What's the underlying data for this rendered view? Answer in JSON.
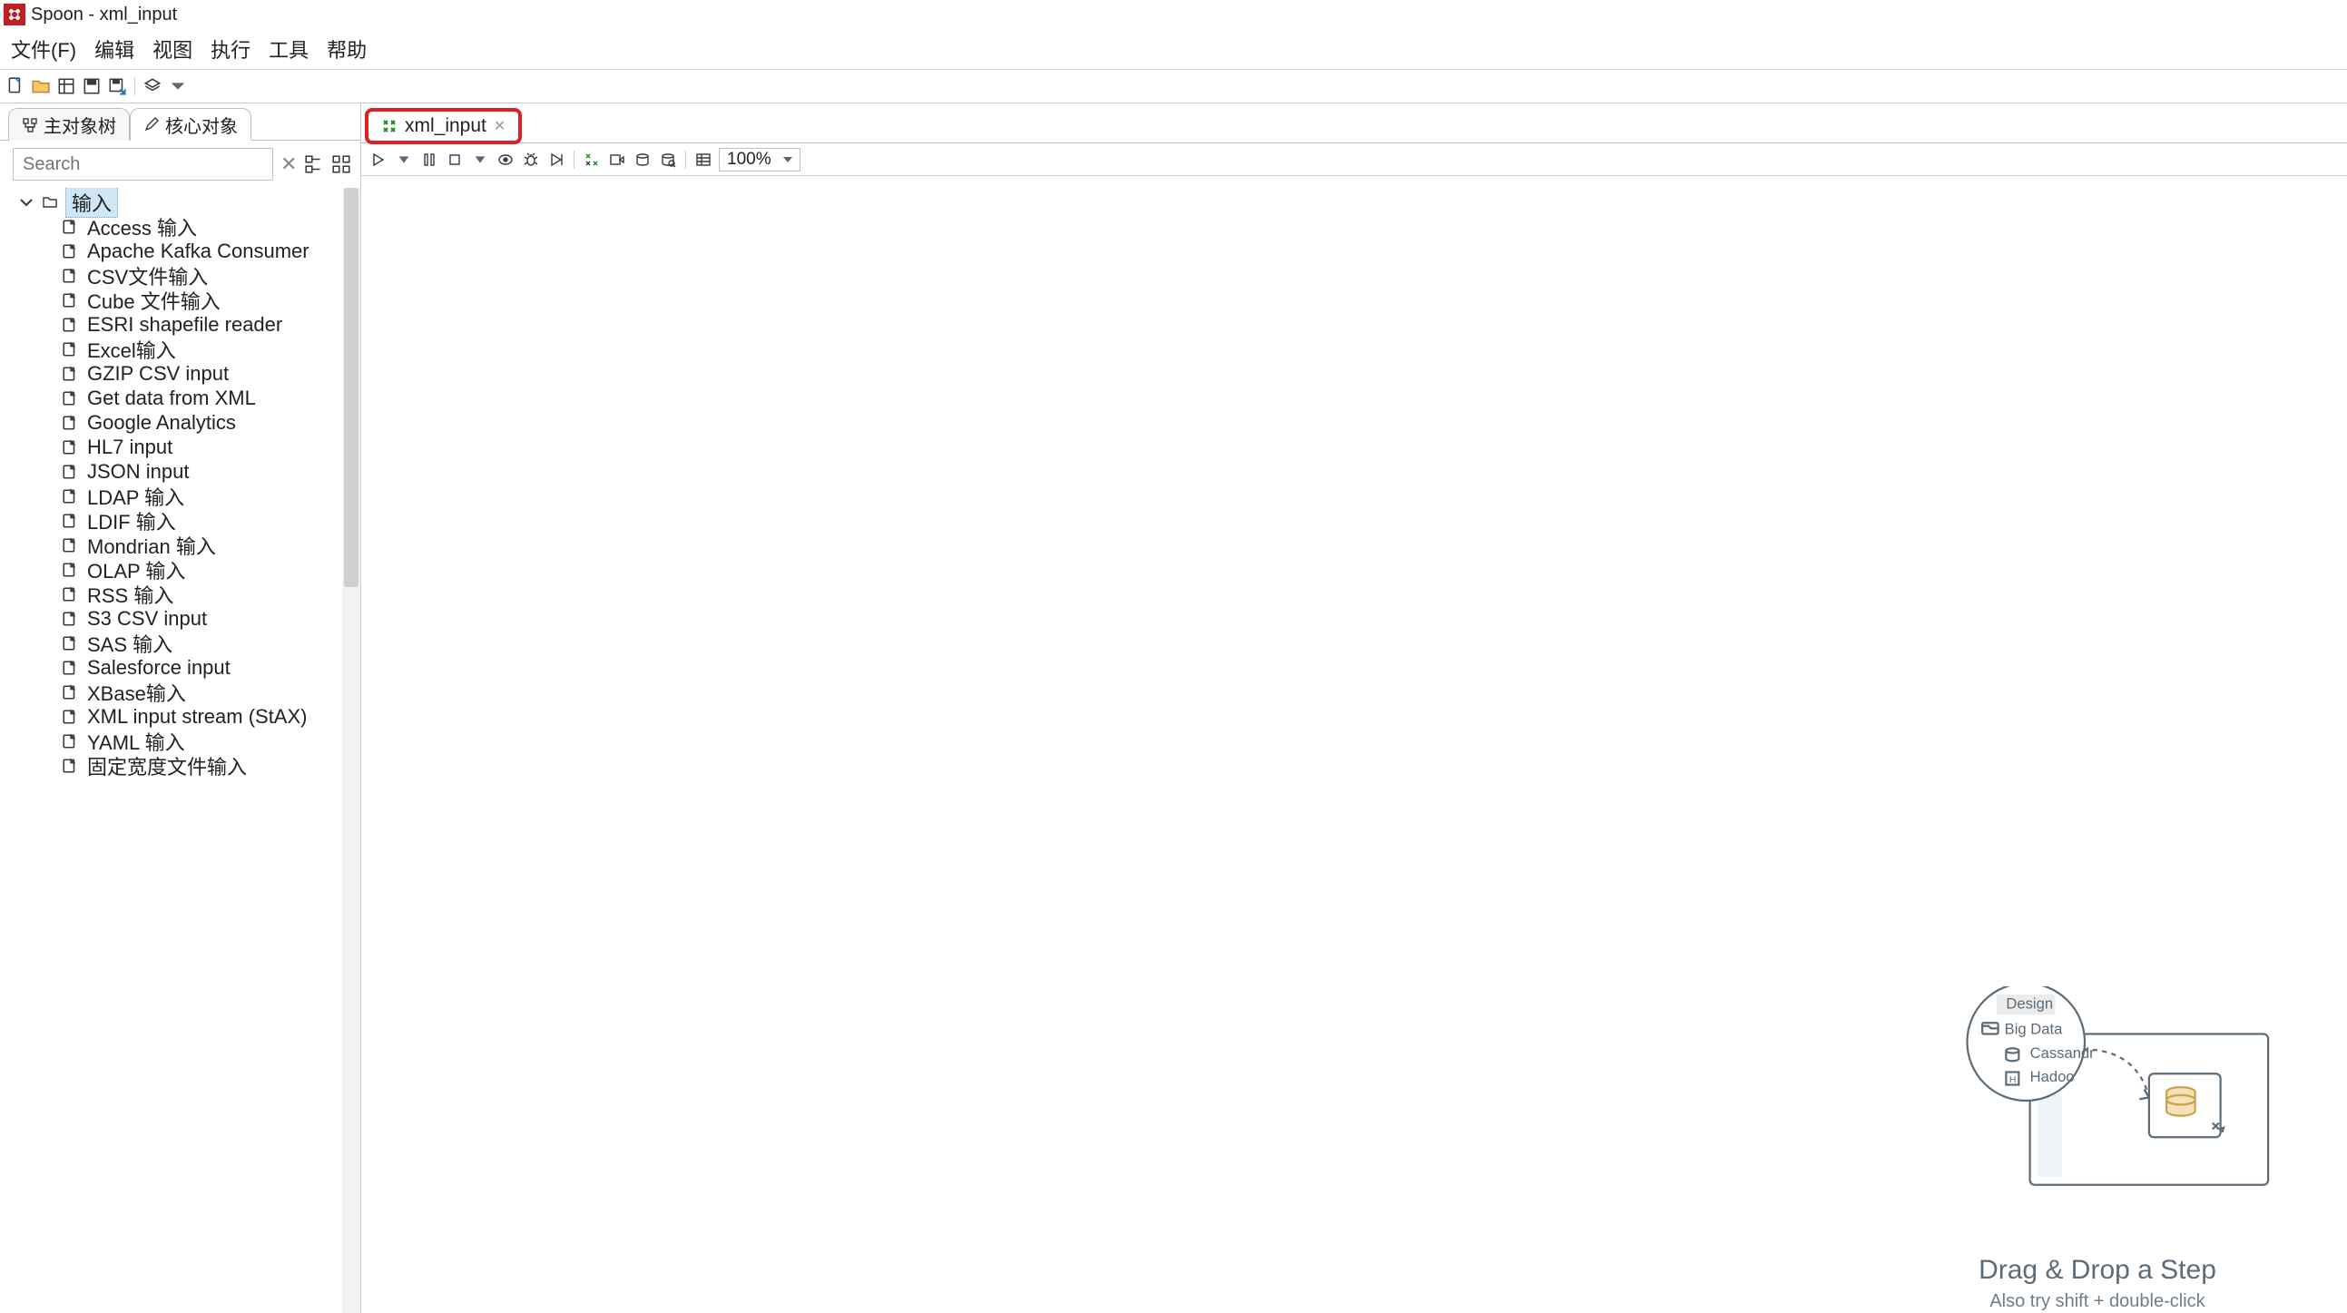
{
  "window": {
    "title": "Spoon - xml_input"
  },
  "menu": {
    "file": "文件(F)",
    "edit": "编辑",
    "view": "视图",
    "action": "执行",
    "tools": "工具",
    "help": "帮助"
  },
  "leftTabs": {
    "tab1": "主对象树",
    "tab2": "核心对象"
  },
  "search": {
    "placeholder": "Search"
  },
  "tree": {
    "folder": "输入",
    "items": [
      "Access 输入",
      "Apache Kafka Consumer",
      "CSV文件输入",
      "Cube 文件输入",
      "ESRI shapefile reader",
      "Excel输入",
      "GZIP CSV input",
      "Get data from XML",
      "Google Analytics",
      "HL7 input",
      "JSON input",
      "LDAP 输入",
      "LDIF 输入",
      "Mondrian 输入",
      "OLAP 输入",
      "RSS 输入",
      "S3 CSV input",
      "SAS 输入",
      "Salesforce input",
      "XBase输入",
      "XML input stream (StAX)",
      "YAML 输入",
      "固定宽度文件输入"
    ]
  },
  "editorTab": {
    "label": "xml_input"
  },
  "zoom": {
    "value": "100%"
  },
  "hint": {
    "lens_tab": "Design",
    "lens_folder": "Big Data",
    "lens_item1": "Cassandr",
    "lens_item2": "Hadoo",
    "title": "Drag & Drop a Step",
    "sub": "Also try shift + double-click"
  }
}
